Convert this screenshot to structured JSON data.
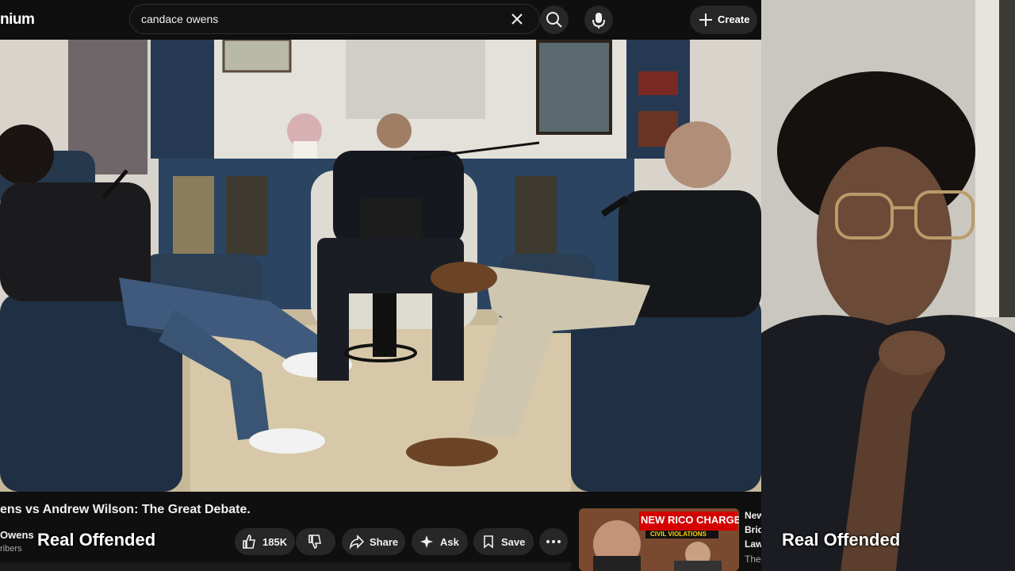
{
  "header": {
    "logo_partial": "nium",
    "search_value": "candace owens",
    "create_label": "Create"
  },
  "video": {
    "title": "ens vs Andrew Wilson: The Great Debate.",
    "channel_partial": "Owens",
    "subs_partial": "ribers",
    "like_count": "185K",
    "share_label": "Share",
    "ask_label": "Ask",
    "save_label": "Save"
  },
  "recommendation": {
    "thumb_text_1": "NEW RICO CHARGES!",
    "thumb_text_2": "CIVIL VIOLATIONS",
    "side_1": "New",
    "side_2": "Brid",
    "side_3": "Law",
    "side_4": "The"
  },
  "overlay": {
    "left_name": "Real Offended",
    "right_name": "Real Offended"
  },
  "colors": {
    "bg": "#0f0f0f",
    "pill": "#272727",
    "accent_red": "#d40000"
  }
}
